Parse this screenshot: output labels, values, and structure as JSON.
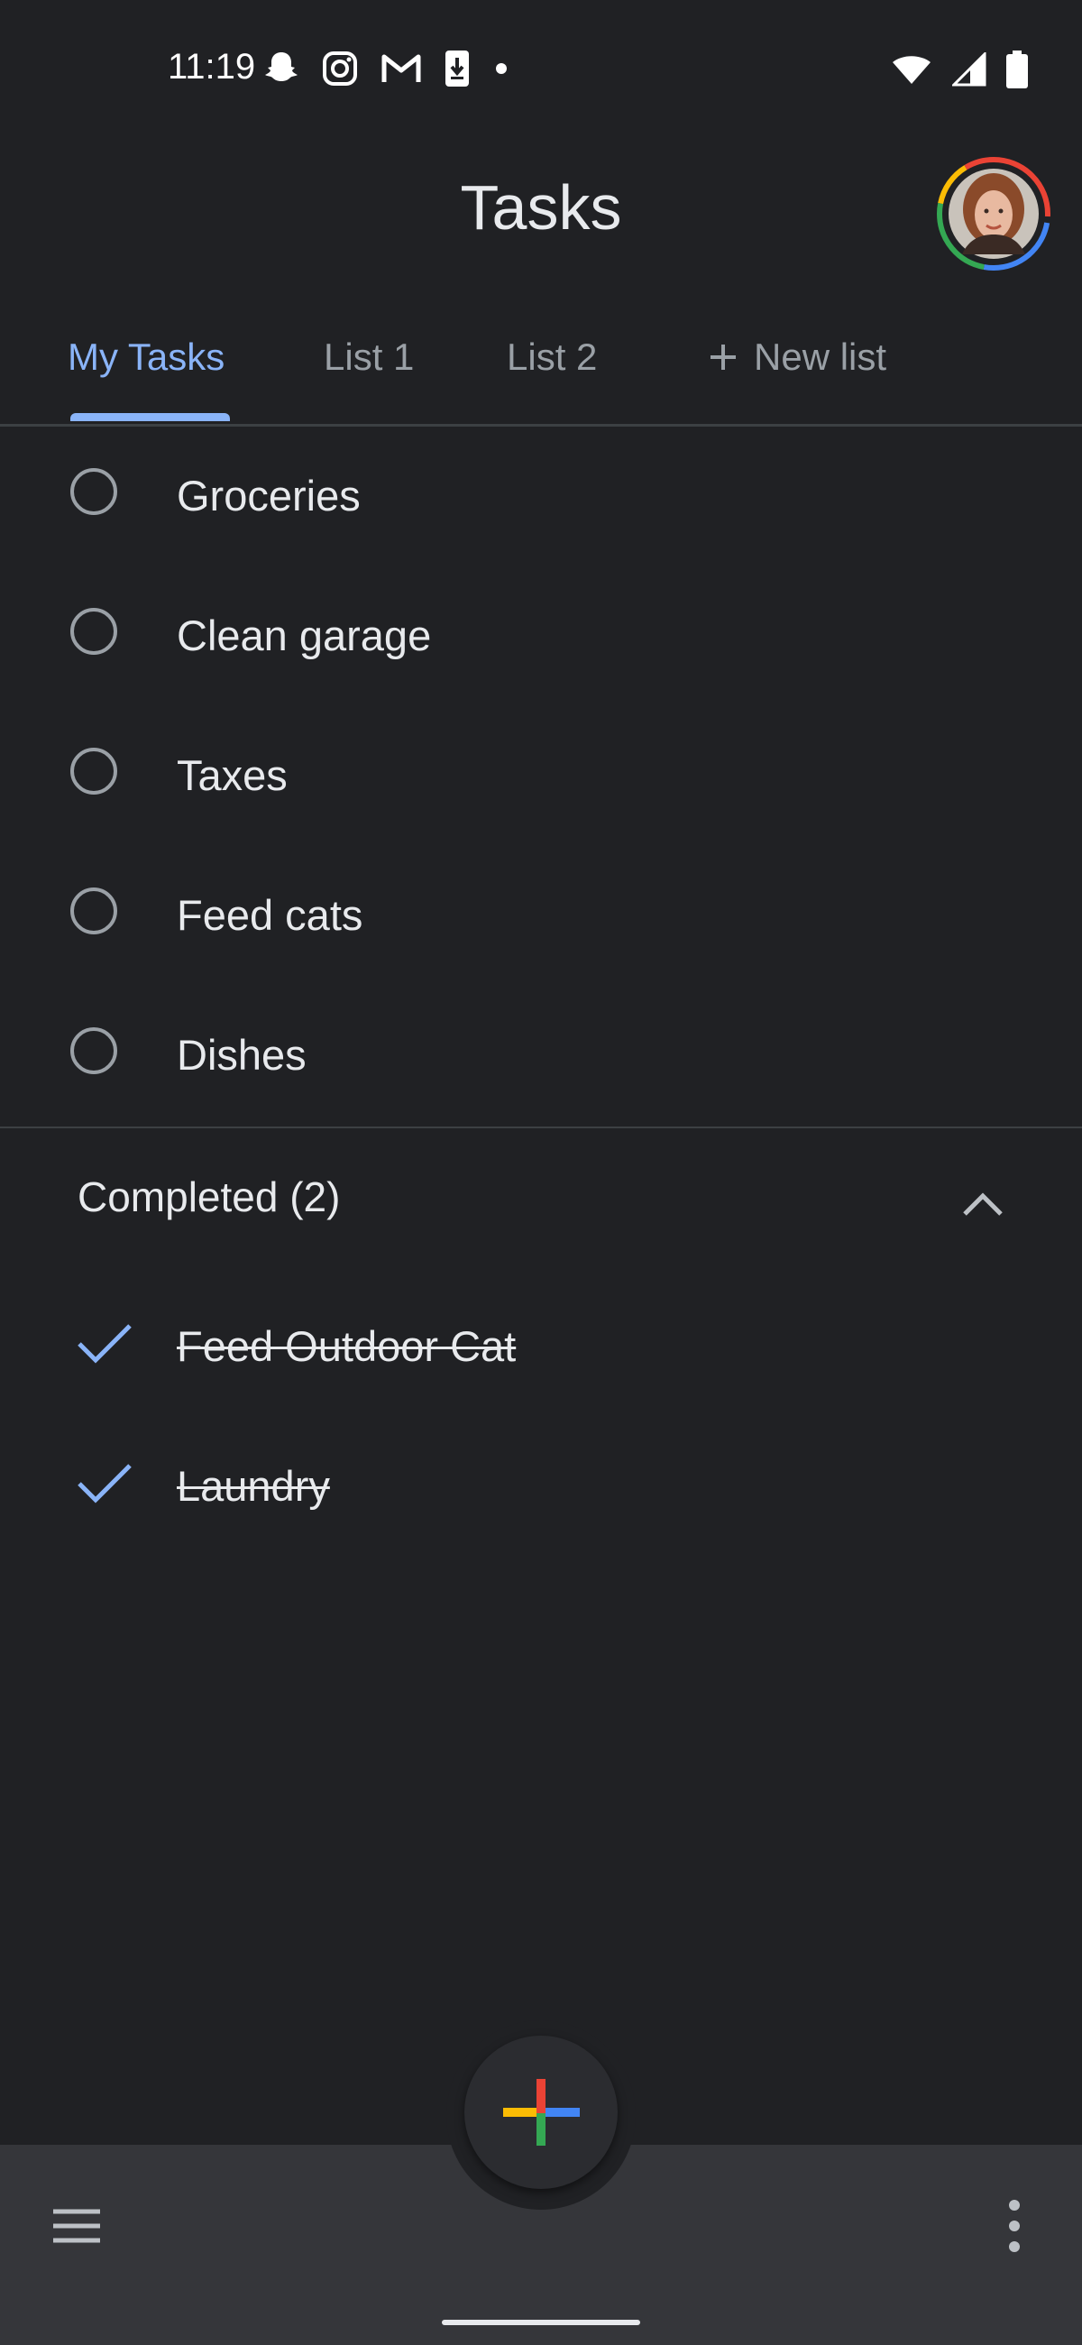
{
  "status_bar": {
    "time": "11:19",
    "icons": [
      "snapchat-icon",
      "instagram-icon",
      "gmail-icon",
      "download-icon",
      "dot-icon",
      "wifi-icon",
      "signal-icon",
      "battery-icon"
    ]
  },
  "header": {
    "title": "Tasks",
    "avatar_ring_colors": [
      "#ea4335",
      "#fbbc04",
      "#34a853",
      "#4285f4"
    ]
  },
  "tabs": [
    {
      "label": "My Tasks",
      "active": true
    },
    {
      "label": "List 1",
      "active": false
    },
    {
      "label": "List 2",
      "active": false
    },
    {
      "label": "New list",
      "active": false,
      "icon": "plus-icon"
    }
  ],
  "tasks": [
    {
      "title": "Groceries"
    },
    {
      "title": "Clean garage"
    },
    {
      "title": "Taxes"
    },
    {
      "title": "Feed cats"
    },
    {
      "title": "Dishes"
    }
  ],
  "completed": {
    "label": "Completed (2)",
    "expanded": true,
    "items": [
      {
        "title": "Feed Outdoor Cat "
      },
      {
        "title": "Laundry"
      }
    ]
  },
  "colors": {
    "accent": "#8ab4f8",
    "background": "#202124",
    "bottom_bar": "#35363a"
  },
  "fab": {
    "icon": "plus-multicolor-icon",
    "colors": [
      "#ea4335",
      "#fbbc04",
      "#34a853",
      "#4285f4"
    ]
  }
}
